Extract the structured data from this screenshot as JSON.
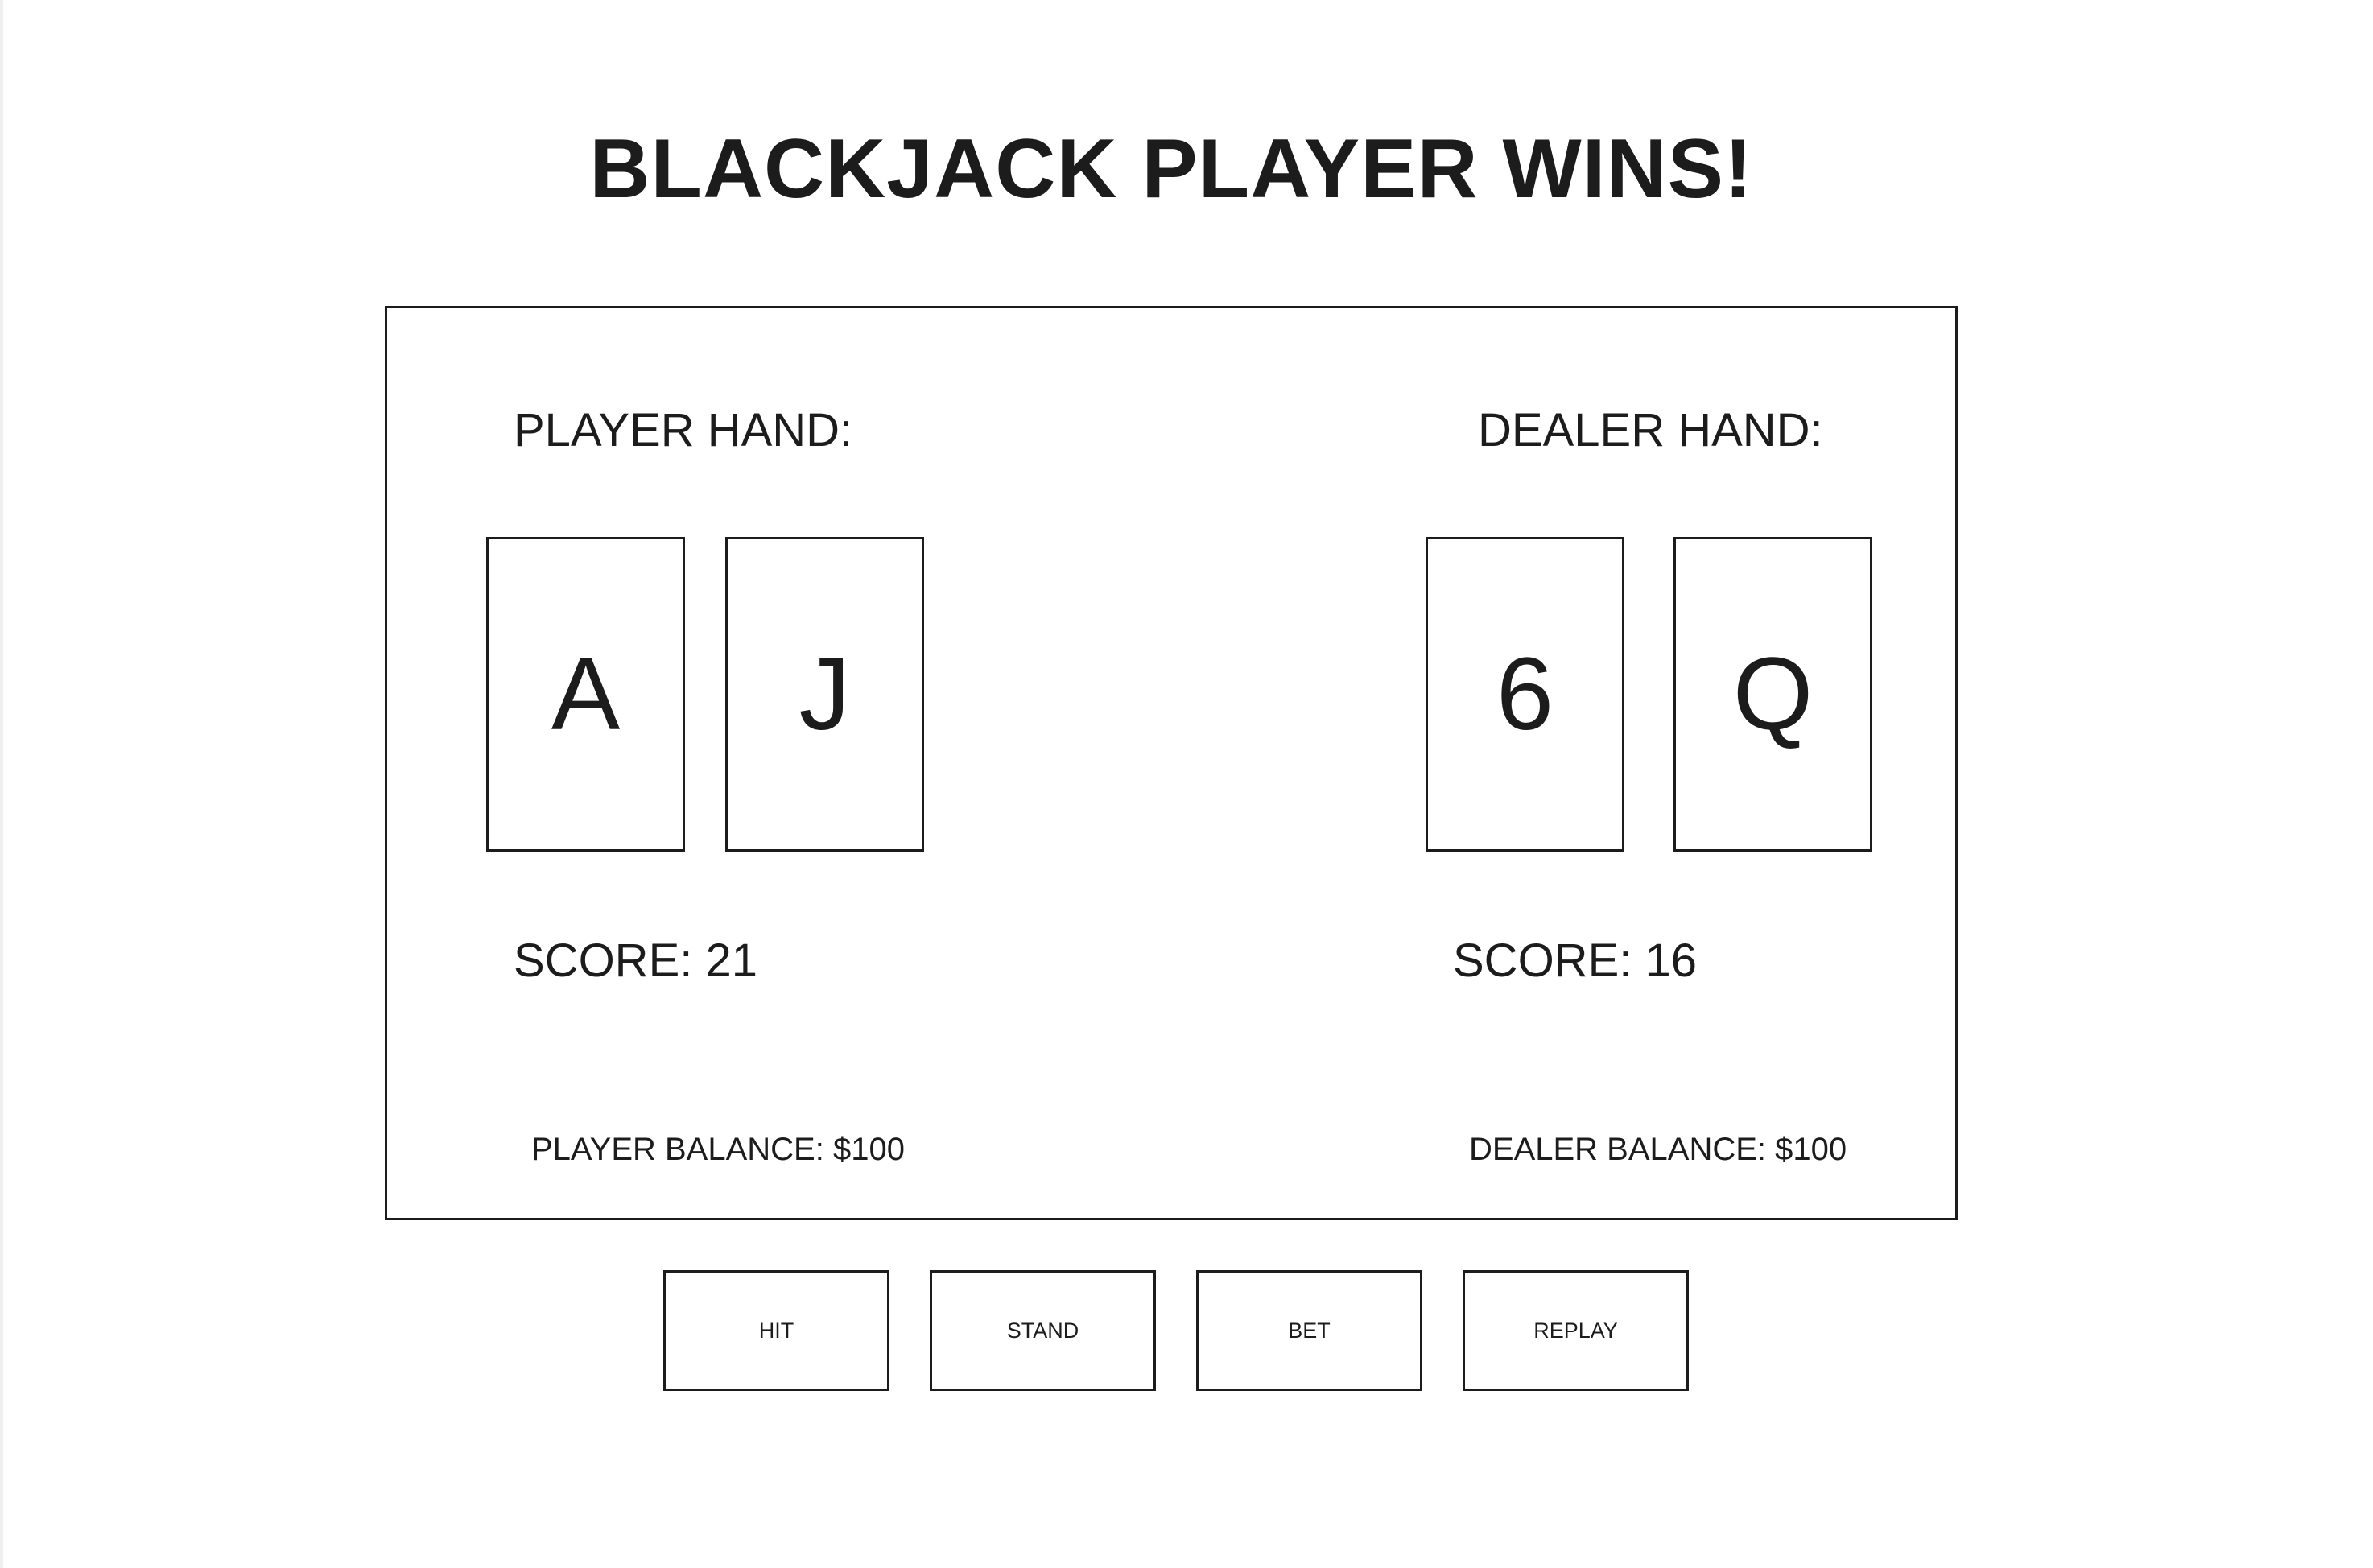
{
  "game": {
    "title": "BLACKJACK PLAYER WINS!"
  },
  "player": {
    "hand_label": "PLAYER HAND:",
    "cards": [
      "A",
      "J"
    ],
    "score_text": "SCORE: 21",
    "balance_text": "PLAYER BALANCE: $100"
  },
  "dealer": {
    "hand_label": "DEALER HAND:",
    "cards": [
      "6",
      "Q"
    ],
    "score_text": "SCORE: 16",
    "balance_text": "DEALER BALANCE: $100"
  },
  "controls": {
    "hit_label": "HIT",
    "stand_label": "STAND",
    "bet_label": "BET",
    "replay_label": "REPLAY"
  },
  "colors": {
    "background": "#ffffff",
    "ink": "#1c1c1c"
  }
}
